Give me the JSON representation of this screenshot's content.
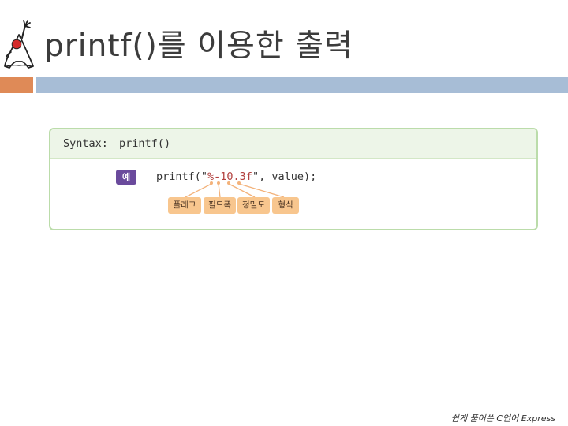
{
  "slide": {
    "title": "printf()를 이용한 출력",
    "footer": "쉽게 풀어쓴 C언어 Express"
  },
  "syntax_box": {
    "header_label": "Syntax:",
    "header_function": "printf()",
    "example_badge": "예",
    "code_before": "printf(\"",
    "code_format": "%-10.3f",
    "code_after": "\", value);",
    "parts": [
      "플래그",
      "필드폭",
      "정밀도",
      "형식"
    ]
  },
  "colors": {
    "accent_orange": "#df8a57",
    "accent_blue": "#a7bdd6",
    "box_border": "#bbdcaa",
    "badge_purple": "#6a4a9c",
    "tag_orange": "#f8c68e"
  },
  "icons": {
    "logo": "java-duke-mascot-icon"
  }
}
